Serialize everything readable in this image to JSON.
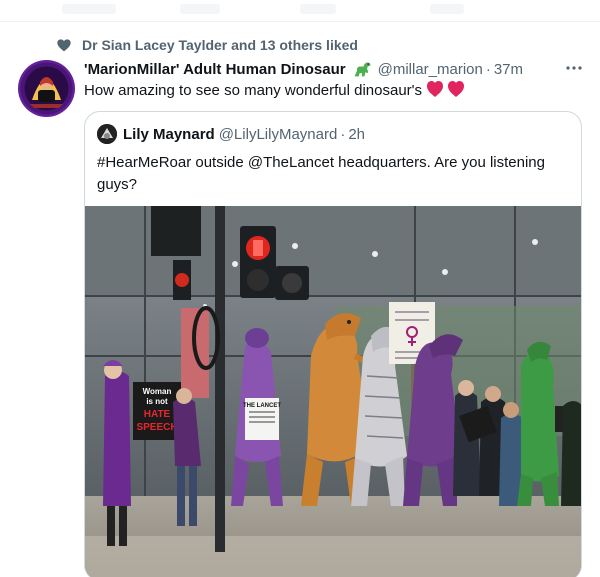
{
  "social_context": {
    "liked_text": "Dr Sian Lacey Taylder and 13 others liked",
    "icon": "heart-icon"
  },
  "tweet": {
    "author_name": "'MarionMillar' Adult Human Dinosaur",
    "author_badge_icon": "dinosaur-emoji-icon",
    "handle": "@millar_marion",
    "separator": "·",
    "time": "37m",
    "text": "How amazing to see so many wonderful dinosaur's",
    "text_emoji": [
      "red-heart-icon",
      "red-heart-icon"
    ],
    "more_icon": "more-options-icon"
  },
  "quoted_tweet": {
    "author_name": "Lily Maynard",
    "handle": "@LilyLilyMaynard",
    "separator": "·",
    "time": "2h",
    "text": "#HearMeRoar outside @TheLancet headquarters. Are you listening guys?",
    "photo": {
      "signs": {
        "hate_speech_line1": "Woman",
        "hate_speech_line2": "is not",
        "hate_speech_line3": "HATE",
        "hate_speech_line4": "SPEECH",
        "lancet_sign": "THE LANCET"
      }
    }
  },
  "colors": {
    "text_primary": "#0f1419",
    "text_secondary": "#536471",
    "border": "#cfd9de",
    "heart_red": "#f91880",
    "avatar_purple": "#5b1b8c"
  }
}
